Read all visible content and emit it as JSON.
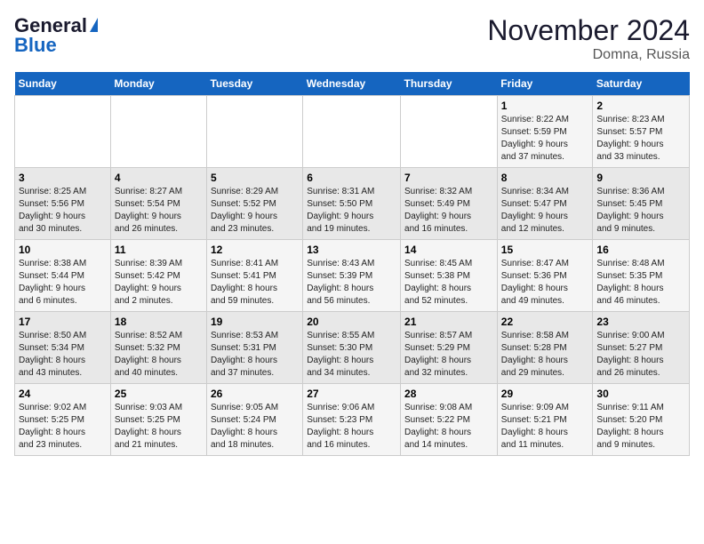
{
  "header": {
    "logo_line1": "General",
    "logo_line2": "Blue",
    "title": "November 2024",
    "subtitle": "Domna, Russia"
  },
  "days_of_week": [
    "Sunday",
    "Monday",
    "Tuesday",
    "Wednesday",
    "Thursday",
    "Friday",
    "Saturday"
  ],
  "weeks": [
    [
      {
        "day": "",
        "info": ""
      },
      {
        "day": "",
        "info": ""
      },
      {
        "day": "",
        "info": ""
      },
      {
        "day": "",
        "info": ""
      },
      {
        "day": "",
        "info": ""
      },
      {
        "day": "1",
        "info": "Sunrise: 8:22 AM\nSunset: 5:59 PM\nDaylight: 9 hours\nand 37 minutes."
      },
      {
        "day": "2",
        "info": "Sunrise: 8:23 AM\nSunset: 5:57 PM\nDaylight: 9 hours\nand 33 minutes."
      }
    ],
    [
      {
        "day": "3",
        "info": "Sunrise: 8:25 AM\nSunset: 5:56 PM\nDaylight: 9 hours\nand 30 minutes."
      },
      {
        "day": "4",
        "info": "Sunrise: 8:27 AM\nSunset: 5:54 PM\nDaylight: 9 hours\nand 26 minutes."
      },
      {
        "day": "5",
        "info": "Sunrise: 8:29 AM\nSunset: 5:52 PM\nDaylight: 9 hours\nand 23 minutes."
      },
      {
        "day": "6",
        "info": "Sunrise: 8:31 AM\nSunset: 5:50 PM\nDaylight: 9 hours\nand 19 minutes."
      },
      {
        "day": "7",
        "info": "Sunrise: 8:32 AM\nSunset: 5:49 PM\nDaylight: 9 hours\nand 16 minutes."
      },
      {
        "day": "8",
        "info": "Sunrise: 8:34 AM\nSunset: 5:47 PM\nDaylight: 9 hours\nand 12 minutes."
      },
      {
        "day": "9",
        "info": "Sunrise: 8:36 AM\nSunset: 5:45 PM\nDaylight: 9 hours\nand 9 minutes."
      }
    ],
    [
      {
        "day": "10",
        "info": "Sunrise: 8:38 AM\nSunset: 5:44 PM\nDaylight: 9 hours\nand 6 minutes."
      },
      {
        "day": "11",
        "info": "Sunrise: 8:39 AM\nSunset: 5:42 PM\nDaylight: 9 hours\nand 2 minutes."
      },
      {
        "day": "12",
        "info": "Sunrise: 8:41 AM\nSunset: 5:41 PM\nDaylight: 8 hours\nand 59 minutes."
      },
      {
        "day": "13",
        "info": "Sunrise: 8:43 AM\nSunset: 5:39 PM\nDaylight: 8 hours\nand 56 minutes."
      },
      {
        "day": "14",
        "info": "Sunrise: 8:45 AM\nSunset: 5:38 PM\nDaylight: 8 hours\nand 52 minutes."
      },
      {
        "day": "15",
        "info": "Sunrise: 8:47 AM\nSunset: 5:36 PM\nDaylight: 8 hours\nand 49 minutes."
      },
      {
        "day": "16",
        "info": "Sunrise: 8:48 AM\nSunset: 5:35 PM\nDaylight: 8 hours\nand 46 minutes."
      }
    ],
    [
      {
        "day": "17",
        "info": "Sunrise: 8:50 AM\nSunset: 5:34 PM\nDaylight: 8 hours\nand 43 minutes."
      },
      {
        "day": "18",
        "info": "Sunrise: 8:52 AM\nSunset: 5:32 PM\nDaylight: 8 hours\nand 40 minutes."
      },
      {
        "day": "19",
        "info": "Sunrise: 8:53 AM\nSunset: 5:31 PM\nDaylight: 8 hours\nand 37 minutes."
      },
      {
        "day": "20",
        "info": "Sunrise: 8:55 AM\nSunset: 5:30 PM\nDaylight: 8 hours\nand 34 minutes."
      },
      {
        "day": "21",
        "info": "Sunrise: 8:57 AM\nSunset: 5:29 PM\nDaylight: 8 hours\nand 32 minutes."
      },
      {
        "day": "22",
        "info": "Sunrise: 8:58 AM\nSunset: 5:28 PM\nDaylight: 8 hours\nand 29 minutes."
      },
      {
        "day": "23",
        "info": "Sunrise: 9:00 AM\nSunset: 5:27 PM\nDaylight: 8 hours\nand 26 minutes."
      }
    ],
    [
      {
        "day": "24",
        "info": "Sunrise: 9:02 AM\nSunset: 5:25 PM\nDaylight: 8 hours\nand 23 minutes."
      },
      {
        "day": "25",
        "info": "Sunrise: 9:03 AM\nSunset: 5:25 PM\nDaylight: 8 hours\nand 21 minutes."
      },
      {
        "day": "26",
        "info": "Sunrise: 9:05 AM\nSunset: 5:24 PM\nDaylight: 8 hours\nand 18 minutes."
      },
      {
        "day": "27",
        "info": "Sunrise: 9:06 AM\nSunset: 5:23 PM\nDaylight: 8 hours\nand 16 minutes."
      },
      {
        "day": "28",
        "info": "Sunrise: 9:08 AM\nSunset: 5:22 PM\nDaylight: 8 hours\nand 14 minutes."
      },
      {
        "day": "29",
        "info": "Sunrise: 9:09 AM\nSunset: 5:21 PM\nDaylight: 8 hours\nand 11 minutes."
      },
      {
        "day": "30",
        "info": "Sunrise: 9:11 AM\nSunset: 5:20 PM\nDaylight: 8 hours\nand 9 minutes."
      }
    ]
  ]
}
